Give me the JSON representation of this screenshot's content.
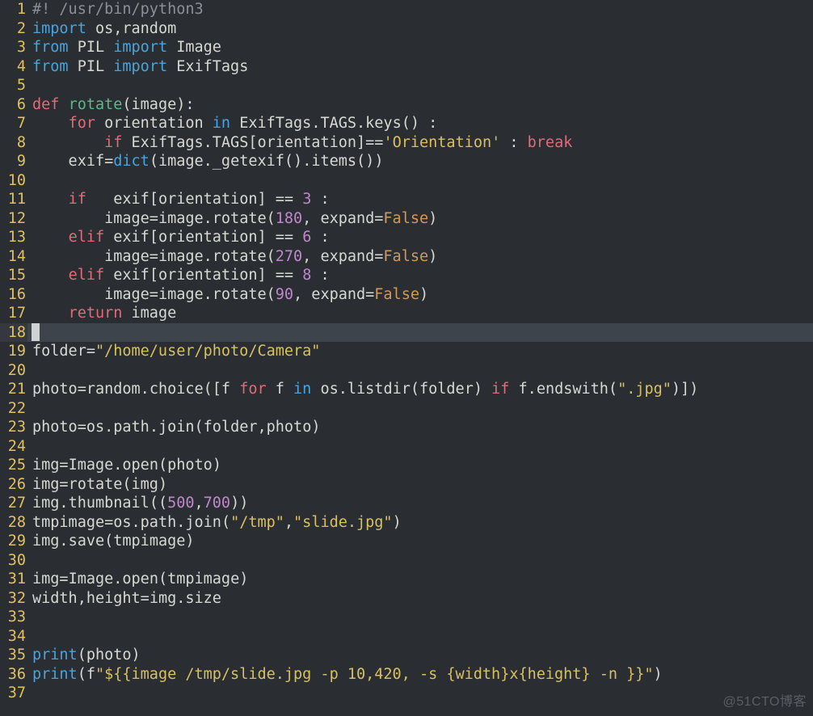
{
  "watermark": "@51CTO博客",
  "current_line": 18,
  "lines": [
    {
      "n": 1,
      "t": [
        [
          "cm",
          "#! /usr/bin/python3"
        ]
      ]
    },
    {
      "n": 2,
      "t": [
        [
          "kw2",
          "import"
        ],
        [
          "pc",
          " os"
        ],
        [
          "op",
          ","
        ],
        [
          "pc",
          "random"
        ]
      ]
    },
    {
      "n": 3,
      "t": [
        [
          "kw2",
          "from"
        ],
        [
          "pc",
          " PIL "
        ],
        [
          "kw2",
          "import"
        ],
        [
          "pc",
          " Image"
        ]
      ]
    },
    {
      "n": 4,
      "t": [
        [
          "kw2",
          "from"
        ],
        [
          "pc",
          " PIL "
        ],
        [
          "kw2",
          "import"
        ],
        [
          "pc",
          " ExifTags"
        ]
      ]
    },
    {
      "n": 5,
      "t": [
        [
          "pc",
          ""
        ]
      ]
    },
    {
      "n": 6,
      "t": [
        [
          "kw",
          "def "
        ],
        [
          "fn",
          "rotate"
        ],
        [
          "op",
          "("
        ],
        [
          "pc",
          "image"
        ],
        [
          "op",
          ")"
        ],
        [
          "op",
          ":"
        ]
      ]
    },
    {
      "n": 7,
      "t": [
        [
          "pc",
          "    "
        ],
        [
          "kw",
          "for"
        ],
        [
          "pc",
          " orientation "
        ],
        [
          "kw2",
          "in"
        ],
        [
          "pc",
          " ExifTags"
        ],
        [
          "op",
          "."
        ],
        [
          "pc",
          "TAGS"
        ],
        [
          "op",
          "."
        ],
        [
          "pc",
          "keys"
        ],
        [
          "op",
          "()"
        ],
        [
          "pc",
          " "
        ],
        [
          "op",
          ":"
        ]
      ]
    },
    {
      "n": 8,
      "t": [
        [
          "pc",
          "        "
        ],
        [
          "kw",
          "if"
        ],
        [
          "pc",
          " ExifTags"
        ],
        [
          "op",
          "."
        ],
        [
          "pc",
          "TAGS"
        ],
        [
          "op",
          "["
        ],
        [
          "pc",
          "orientation"
        ],
        [
          "op",
          "]"
        ],
        [
          "op",
          "=="
        ],
        [
          "str",
          "'Orientation'"
        ],
        [
          "pc",
          " "
        ],
        [
          "op",
          ":"
        ],
        [
          "pc",
          " "
        ],
        [
          "kw",
          "break"
        ]
      ]
    },
    {
      "n": 9,
      "t": [
        [
          "pc",
          "    exif"
        ],
        [
          "op",
          "="
        ],
        [
          "bi",
          "dict"
        ],
        [
          "op",
          "("
        ],
        [
          "pc",
          "image"
        ],
        [
          "op",
          "."
        ],
        [
          "pc",
          "_getexif"
        ],
        [
          "op",
          "()"
        ],
        [
          "op",
          "."
        ],
        [
          "pc",
          "items"
        ],
        [
          "op",
          "()"
        ],
        [
          "op",
          ")"
        ]
      ]
    },
    {
      "n": 10,
      "t": [
        [
          "pc",
          ""
        ]
      ]
    },
    {
      "n": 11,
      "t": [
        [
          "pc",
          "    "
        ],
        [
          "kw",
          "if"
        ],
        [
          "pc",
          "   exif"
        ],
        [
          "op",
          "["
        ],
        [
          "pc",
          "orientation"
        ],
        [
          "op",
          "]"
        ],
        [
          "pc",
          " "
        ],
        [
          "op",
          "=="
        ],
        [
          "pc",
          " "
        ],
        [
          "num",
          "3"
        ],
        [
          "pc",
          " "
        ],
        [
          "op",
          ":"
        ]
      ]
    },
    {
      "n": 12,
      "t": [
        [
          "pc",
          "        image"
        ],
        [
          "op",
          "="
        ],
        [
          "pc",
          "image"
        ],
        [
          "op",
          "."
        ],
        [
          "pc",
          "rotate"
        ],
        [
          "op",
          "("
        ],
        [
          "num",
          "180"
        ],
        [
          "op",
          ","
        ],
        [
          "pc",
          " expand"
        ],
        [
          "op",
          "="
        ],
        [
          "bool",
          "False"
        ],
        [
          "op",
          ")"
        ]
      ]
    },
    {
      "n": 13,
      "t": [
        [
          "pc",
          "    "
        ],
        [
          "kw",
          "elif"
        ],
        [
          "pc",
          " exif"
        ],
        [
          "op",
          "["
        ],
        [
          "pc",
          "orientation"
        ],
        [
          "op",
          "]"
        ],
        [
          "pc",
          " "
        ],
        [
          "op",
          "=="
        ],
        [
          "pc",
          " "
        ],
        [
          "num",
          "6"
        ],
        [
          "pc",
          " "
        ],
        [
          "op",
          ":"
        ]
      ]
    },
    {
      "n": 14,
      "t": [
        [
          "pc",
          "        image"
        ],
        [
          "op",
          "="
        ],
        [
          "pc",
          "image"
        ],
        [
          "op",
          "."
        ],
        [
          "pc",
          "rotate"
        ],
        [
          "op",
          "("
        ],
        [
          "num",
          "270"
        ],
        [
          "op",
          ","
        ],
        [
          "pc",
          " expand"
        ],
        [
          "op",
          "="
        ],
        [
          "bool",
          "False"
        ],
        [
          "op",
          ")"
        ]
      ]
    },
    {
      "n": 15,
      "t": [
        [
          "pc",
          "    "
        ],
        [
          "kw",
          "elif"
        ],
        [
          "pc",
          " exif"
        ],
        [
          "op",
          "["
        ],
        [
          "pc",
          "orientation"
        ],
        [
          "op",
          "]"
        ],
        [
          "pc",
          " "
        ],
        [
          "op",
          "=="
        ],
        [
          "pc",
          " "
        ],
        [
          "num",
          "8"
        ],
        [
          "pc",
          " "
        ],
        [
          "op",
          ":"
        ]
      ]
    },
    {
      "n": 16,
      "t": [
        [
          "pc",
          "        image"
        ],
        [
          "op",
          "="
        ],
        [
          "pc",
          "image"
        ],
        [
          "op",
          "."
        ],
        [
          "pc",
          "rotate"
        ],
        [
          "op",
          "("
        ],
        [
          "num",
          "90"
        ],
        [
          "op",
          ","
        ],
        [
          "pc",
          " expand"
        ],
        [
          "op",
          "="
        ],
        [
          "bool",
          "False"
        ],
        [
          "op",
          ")"
        ]
      ]
    },
    {
      "n": 17,
      "t": [
        [
          "pc",
          "    "
        ],
        [
          "kw",
          "return"
        ],
        [
          "pc",
          " image"
        ]
      ]
    },
    {
      "n": 18,
      "t": [
        [
          "cursor",
          ""
        ]
      ]
    },
    {
      "n": 19,
      "t": [
        [
          "pc",
          "folder"
        ],
        [
          "op",
          "="
        ],
        [
          "str",
          "\"/home/user/photo/Camera\""
        ]
      ]
    },
    {
      "n": 20,
      "t": [
        [
          "pc",
          ""
        ]
      ]
    },
    {
      "n": 21,
      "t": [
        [
          "pc",
          "photo"
        ],
        [
          "op",
          "="
        ],
        [
          "pc",
          "random"
        ],
        [
          "op",
          "."
        ],
        [
          "pc",
          "choice"
        ],
        [
          "op",
          "(["
        ],
        [
          "pc",
          "f "
        ],
        [
          "kw",
          "for"
        ],
        [
          "pc",
          " f "
        ],
        [
          "kw2",
          "in"
        ],
        [
          "pc",
          " os"
        ],
        [
          "op",
          "."
        ],
        [
          "pc",
          "listdir"
        ],
        [
          "op",
          "("
        ],
        [
          "pc",
          "folder"
        ],
        [
          "op",
          ")"
        ],
        [
          "pc",
          " "
        ],
        [
          "kw",
          "if"
        ],
        [
          "pc",
          " f"
        ],
        [
          "op",
          "."
        ],
        [
          "pc",
          "endswith"
        ],
        [
          "op",
          "("
        ],
        [
          "str",
          "\".jpg\""
        ],
        [
          "op",
          ")])"
        ]
      ]
    },
    {
      "n": 22,
      "t": [
        [
          "pc",
          ""
        ]
      ]
    },
    {
      "n": 23,
      "t": [
        [
          "pc",
          "photo"
        ],
        [
          "op",
          "="
        ],
        [
          "pc",
          "os"
        ],
        [
          "op",
          "."
        ],
        [
          "pc",
          "path"
        ],
        [
          "op",
          "."
        ],
        [
          "pc",
          "join"
        ],
        [
          "op",
          "("
        ],
        [
          "pc",
          "folder"
        ],
        [
          "op",
          ","
        ],
        [
          "pc",
          "photo"
        ],
        [
          "op",
          ")"
        ]
      ]
    },
    {
      "n": 24,
      "t": [
        [
          "pc",
          ""
        ]
      ]
    },
    {
      "n": 25,
      "t": [
        [
          "pc",
          "img"
        ],
        [
          "op",
          "="
        ],
        [
          "pc",
          "Image"
        ],
        [
          "op",
          "."
        ],
        [
          "pc",
          "open"
        ],
        [
          "op",
          "("
        ],
        [
          "pc",
          "photo"
        ],
        [
          "op",
          ")"
        ]
      ]
    },
    {
      "n": 26,
      "t": [
        [
          "pc",
          "img"
        ],
        [
          "op",
          "="
        ],
        [
          "pc",
          "rotate"
        ],
        [
          "op",
          "("
        ],
        [
          "pc",
          "img"
        ],
        [
          "op",
          ")"
        ]
      ]
    },
    {
      "n": 27,
      "t": [
        [
          "pc",
          "img"
        ],
        [
          "op",
          "."
        ],
        [
          "pc",
          "thumbnail"
        ],
        [
          "op",
          "(("
        ],
        [
          "num",
          "500"
        ],
        [
          "op",
          ","
        ],
        [
          "num",
          "700"
        ],
        [
          "op",
          "))"
        ]
      ]
    },
    {
      "n": 28,
      "t": [
        [
          "pc",
          "tmpimage"
        ],
        [
          "op",
          "="
        ],
        [
          "pc",
          "os"
        ],
        [
          "op",
          "."
        ],
        [
          "pc",
          "path"
        ],
        [
          "op",
          "."
        ],
        [
          "pc",
          "join"
        ],
        [
          "op",
          "("
        ],
        [
          "str",
          "\"/tmp\""
        ],
        [
          "op",
          ","
        ],
        [
          "str",
          "\"slide.jpg\""
        ],
        [
          "op",
          ")"
        ]
      ]
    },
    {
      "n": 29,
      "t": [
        [
          "pc",
          "img"
        ],
        [
          "op",
          "."
        ],
        [
          "pc",
          "save"
        ],
        [
          "op",
          "("
        ],
        [
          "pc",
          "tmpimage"
        ],
        [
          "op",
          ")"
        ]
      ]
    },
    {
      "n": 30,
      "t": [
        [
          "pc",
          ""
        ]
      ]
    },
    {
      "n": 31,
      "t": [
        [
          "pc",
          "img"
        ],
        [
          "op",
          "="
        ],
        [
          "pc",
          "Image"
        ],
        [
          "op",
          "."
        ],
        [
          "pc",
          "open"
        ],
        [
          "op",
          "("
        ],
        [
          "pc",
          "tmpimage"
        ],
        [
          "op",
          ")"
        ]
      ]
    },
    {
      "n": 32,
      "t": [
        [
          "pc",
          "width"
        ],
        [
          "op",
          ","
        ],
        [
          "pc",
          "height"
        ],
        [
          "op",
          "="
        ],
        [
          "pc",
          "img"
        ],
        [
          "op",
          "."
        ],
        [
          "pc",
          "size"
        ]
      ]
    },
    {
      "n": 33,
      "t": [
        [
          "pc",
          ""
        ]
      ]
    },
    {
      "n": 34,
      "t": [
        [
          "pc",
          ""
        ]
      ]
    },
    {
      "n": 35,
      "t": [
        [
          "bi",
          "print"
        ],
        [
          "op",
          "("
        ],
        [
          "pc",
          "photo"
        ],
        [
          "op",
          ")"
        ]
      ]
    },
    {
      "n": 36,
      "t": [
        [
          "bi",
          "print"
        ],
        [
          "op",
          "("
        ],
        [
          "pc",
          "f"
        ],
        [
          "str",
          "\"${{image /tmp/slide.jpg -p 10,420, -s {width}x{height} -n }}\""
        ],
        [
          "op",
          ")"
        ]
      ]
    },
    {
      "n": 37,
      "t": [
        [
          "pc",
          ""
        ]
      ]
    }
  ]
}
